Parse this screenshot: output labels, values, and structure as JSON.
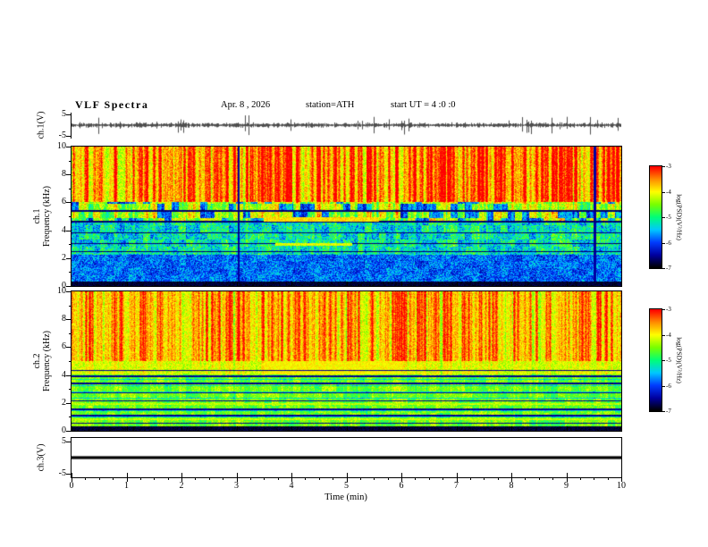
{
  "header": {
    "title": "VLF Spectra",
    "date": "Apr. 8 , 2026",
    "station": "station=ATH",
    "start_ut": "start UT =  4 :0 :0"
  },
  "chart_data": {
    "type": "heatmap",
    "title": "VLF Spectra",
    "xlabel": "Time (min)",
    "x_range": [
      0,
      10
    ],
    "x_ticks": [
      0,
      1,
      2,
      3,
      4,
      5,
      6,
      7,
      8,
      9,
      10
    ],
    "grid": false,
    "panels": [
      {
        "id": "ch1_waveform",
        "type": "line",
        "ylabel": "ch.1(V)",
        "y_range": [
          -5,
          5
        ],
        "y_tick_labels": [
          "5",
          "-5"
        ],
        "description": "broadband noise waveform fluctuating around 0 V with impulsive spikes up to about ±4 V across the full 10 minutes"
      },
      {
        "id": "ch1_spectrogram",
        "type": "heatmap",
        "ylabel_line1": "ch.1",
        "ylabel_line2": "Frequency (kHz)",
        "y_range": [
          0,
          10
        ],
        "y_ticks": [
          0,
          2,
          4,
          6,
          8,
          10
        ],
        "description": "6-10 kHz band yellow-green (log PSD about -4.5) with dense red vertical sferic streaks (about -3); 4.5-6 kHz green-cyan with blue patches; 0.5-4.5 kHz mostly blue (about -6) with cyan speckle; thin dark horizontal interference lines near 5.4, 4.6, 3.8, 3.0 and 2.4 kHz; reddish horizontal emission bands near 4.8 kHz and 3.0 kHz between about 3.5 and 5.6 min; black below 0.3 kHz"
      },
      {
        "id": "ch2_spectrogram",
        "type": "heatmap",
        "ylabel_line1": "ch.2",
        "ylabel_line2": "Frequency (kHz)",
        "y_range": [
          0,
          10
        ],
        "y_ticks": [
          0,
          2,
          4,
          6,
          8,
          10
        ],
        "description": "5-10 kHz green with yellow-orange-red vertical sferic streaks; bright yellow band 4-5 kHz strongest between about 3.5 and 6 min; below 4 kHz green (about -5) with alternating cyan and dark horizontal interference banding and yellowish rows near 1.9 and 0.8 kHz; black below 0.3 kHz"
      },
      {
        "id": "ch3_waveform",
        "type": "line",
        "ylabel": "ch.3(V)",
        "y_range": [
          -5,
          5
        ],
        "y_tick_labels": [
          "5",
          "-5"
        ],
        "description": "flat (dead) channel: constant thick black line at 0 V for the full 10 minutes"
      }
    ],
    "colorbar": {
      "label": "log(PSD)(V²/Hz)",
      "range": [
        -7,
        -3
      ],
      "ticks": [
        -3,
        -4,
        -5,
        -6,
        -7
      ],
      "colors_bottom_to_top": [
        "#000000",
        "#0000a0",
        "#003cff",
        "#00c8ff",
        "#00ff78",
        "#78ff00",
        "#ffff00",
        "#ff8c00",
        "#ff0000"
      ]
    }
  }
}
